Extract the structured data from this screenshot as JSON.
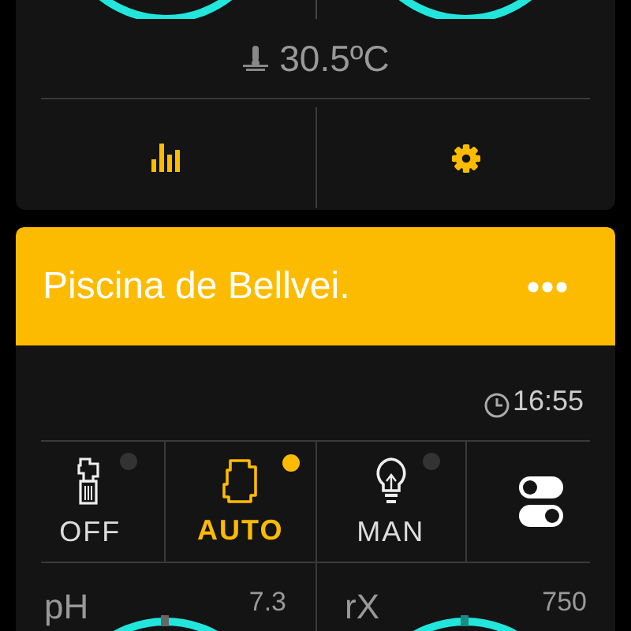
{
  "top_card": {
    "temperature": "30.5ºC"
  },
  "pool": {
    "title": "Piscina de Bellvei.",
    "time": "16:55",
    "modes": [
      {
        "kind": "off",
        "label": "OFF",
        "selected": false
      },
      {
        "kind": "auto",
        "label": "AUTO",
        "selected": true
      },
      {
        "kind": "manual",
        "label": "MAN",
        "selected": false
      },
      {
        "kind": "switches"
      }
    ],
    "gauges": [
      {
        "label": "pH",
        "value": "7.3"
      },
      {
        "label": "rX",
        "value": "750"
      }
    ]
  }
}
